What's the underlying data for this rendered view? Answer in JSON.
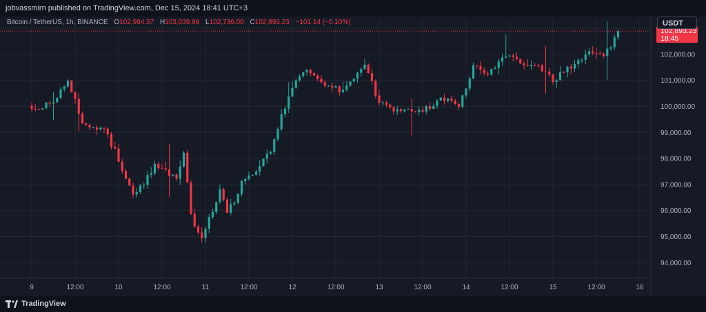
{
  "publish_line": "jobvassmirn published on TradingView.com, Dec 15, 2024 18:41 UTC+3",
  "legend": {
    "symbol": "Bitcoin / TetherUS, 1h, BINANCE",
    "o_label": "O",
    "o_value": "102,994.37",
    "h_label": "H",
    "h_value": "103,039.99",
    "l_label": "L",
    "l_value": "102,736.00",
    "c_label": "C",
    "c_value": "102,893.23",
    "change": "−101.14 (−0.10%)"
  },
  "currency_button": "USDT",
  "price_tag": {
    "price": "102,893.23",
    "countdown": "18:45"
  },
  "footer_brand": "TradingView",
  "colors": {
    "up": "#26a69a",
    "down": "#f23645",
    "background": "#161a25",
    "grid": "#232733",
    "text": "#b2b5be"
  },
  "chart_data": {
    "type": "candlestick",
    "symbol": "Bitcoin / TetherUS",
    "interval": "1h",
    "exchange": "BINANCE",
    "ylim": [
      93400,
      103400
    ],
    "y_ticks": [
      "94,000.00",
      "95,000.00",
      "96,000.00",
      "97,000.00",
      "98,000.00",
      "99,000.00",
      "100,000.00",
      "101,000.00",
      "102,000.00",
      "103,000.00"
    ],
    "x_ticks": [
      "9",
      "12:00",
      "10",
      "12:00",
      "11",
      "12:00",
      "12",
      "12:00",
      "13",
      "12:00",
      "14",
      "12:00",
      "15",
      "12:00",
      "16"
    ],
    "grid": true,
    "last_price": 102893.23,
    "anchors": [
      [
        "2024-12-09 00:00",
        99900
      ],
      [
        "2024-12-09 06:00",
        100100
      ],
      [
        "2024-12-09 10:00",
        101000
      ],
      [
        "2024-12-09 14:00",
        99400
      ],
      [
        "2024-12-09 20:00",
        99100
      ],
      [
        "2024-12-10 00:00",
        98000
      ],
      [
        "2024-12-10 04:00",
        96500
      ],
      [
        "2024-12-10 10:00",
        97700
      ],
      [
        "2024-12-10 16:00",
        97300
      ],
      [
        "2024-12-10 18:00",
        98300
      ],
      [
        "2024-12-10 20:00",
        95800
      ],
      [
        "2024-12-10 23:00",
        94900
      ],
      [
        "2024-12-11 04:00",
        96800
      ],
      [
        "2024-12-11 06:00",
        96000
      ],
      [
        "2024-12-11 08:00",
        96300
      ],
      [
        "2024-12-11 10:00",
        97200
      ],
      [
        "2024-12-11 14:00",
        97600
      ],
      [
        "2024-12-11 18:00",
        98300
      ],
      [
        "2024-12-11 22:00",
        100000
      ],
      [
        "2024-12-12 00:00",
        100700
      ],
      [
        "2024-12-12 04:00",
        101500
      ],
      [
        "2024-12-12 10:00",
        100700
      ],
      [
        "2024-12-12 14:00",
        100600
      ],
      [
        "2024-12-12 20:00",
        101500
      ],
      [
        "2024-12-13 00:00",
        100200
      ],
      [
        "2024-12-13 06:00",
        99800
      ],
      [
        "2024-12-13 12:00",
        99900
      ],
      [
        "2024-12-13 18:00",
        100300
      ],
      [
        "2024-12-13 22:00",
        100100
      ],
      [
        "2024-12-14 02:00",
        101500
      ],
      [
        "2024-12-14 06:00",
        101300
      ],
      [
        "2024-12-14 10:00",
        101900
      ],
      [
        "2024-12-14 14:00",
        101800
      ],
      [
        "2024-12-14 20:00",
        101500
      ],
      [
        "2024-12-15 00:00",
        101000
      ],
      [
        "2024-12-15 06:00",
        101600
      ],
      [
        "2024-12-15 10:00",
        102000
      ],
      [
        "2024-12-15 14:00",
        101900
      ],
      [
        "2024-12-15 18:00",
        102893
      ]
    ]
  }
}
